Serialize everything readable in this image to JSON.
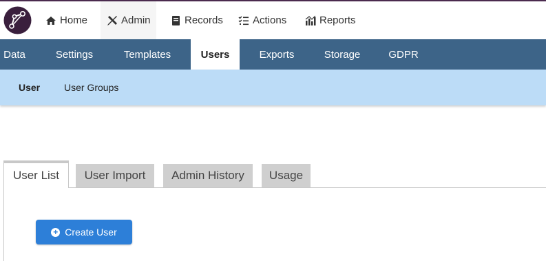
{
  "topnav": {
    "items": [
      {
        "label": "Home",
        "icon": "home-icon"
      },
      {
        "label": "Admin",
        "icon": "tools-icon",
        "active": true
      },
      {
        "label": "Records",
        "icon": "book-icon"
      },
      {
        "label": "Actions",
        "icon": "checklist-icon"
      },
      {
        "label": "Reports",
        "icon": "bar-chart-icon"
      }
    ]
  },
  "subnav": {
    "items": [
      {
        "label": "Data"
      },
      {
        "label": "Settings"
      },
      {
        "label": "Templates"
      },
      {
        "label": "Users",
        "active": true
      },
      {
        "label": "Exports"
      },
      {
        "label": "Storage"
      },
      {
        "label": "GDPR"
      }
    ]
  },
  "subsubnav": {
    "items": [
      {
        "label": "User",
        "active": true
      },
      {
        "label": "User Groups"
      }
    ]
  },
  "tabs": [
    {
      "label": "User List",
      "active": true
    },
    {
      "label": "User Import"
    },
    {
      "label": "Admin History"
    },
    {
      "label": "Usage"
    }
  ],
  "actions": {
    "create_user_label": "Create User",
    "create_user_icon": "plus-circle-icon"
  },
  "colors": {
    "accent": "#3d6488",
    "subnav_light": "#bcdcf7",
    "button": "#2d7fd8",
    "brand": "#4a2a4e"
  }
}
